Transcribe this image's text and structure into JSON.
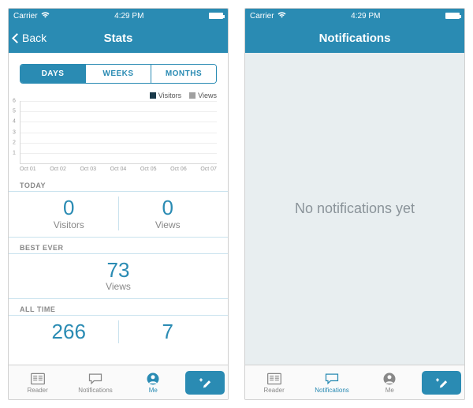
{
  "status": {
    "carrier": "Carrier",
    "time": "4:29 PM"
  },
  "stats_screen": {
    "back_label": "Back",
    "title": "Stats",
    "segments": [
      "DAYS",
      "WEEKS",
      "MONTHS"
    ],
    "legend": {
      "visitors": "Visitors",
      "views": "Views"
    },
    "chart_data": {
      "type": "bar",
      "categories": [
        "Oct 01",
        "Oct 02",
        "Oct 03",
        "Oct 04",
        "Oct 05",
        "Oct 06",
        "Oct 07"
      ],
      "series": [
        {
          "name": "Visitors",
          "values": [
            0,
            0,
            0,
            0,
            0,
            0,
            0
          ]
        },
        {
          "name": "Views",
          "values": [
            0,
            0,
            0,
            0,
            0,
            0,
            0
          ]
        }
      ],
      "yticks": [
        1,
        2,
        3,
        4,
        5,
        6
      ],
      "ylim": [
        0,
        6
      ],
      "xlabel": "",
      "ylabel": ""
    },
    "sections": {
      "today": {
        "label": "TODAY",
        "visitors": {
          "value": "0",
          "label": "Visitors"
        },
        "views": {
          "value": "0",
          "label": "Views"
        }
      },
      "best_ever": {
        "label": "BEST EVER",
        "views": {
          "value": "73",
          "label": "Views"
        }
      },
      "all_time": {
        "label": "ALL TIME",
        "left": {
          "value": "266"
        },
        "right": {
          "value": "7"
        }
      }
    }
  },
  "notifications_screen": {
    "title": "Notifications",
    "empty_text": "No notifications yet"
  },
  "tabbar": {
    "reader": "Reader",
    "notifications": "Notifications",
    "me": "Me"
  },
  "colors": {
    "accent": "#2a8bb3",
    "visitors_swatch": "#1a3a4a",
    "views_swatch": "#a0a0a0"
  }
}
